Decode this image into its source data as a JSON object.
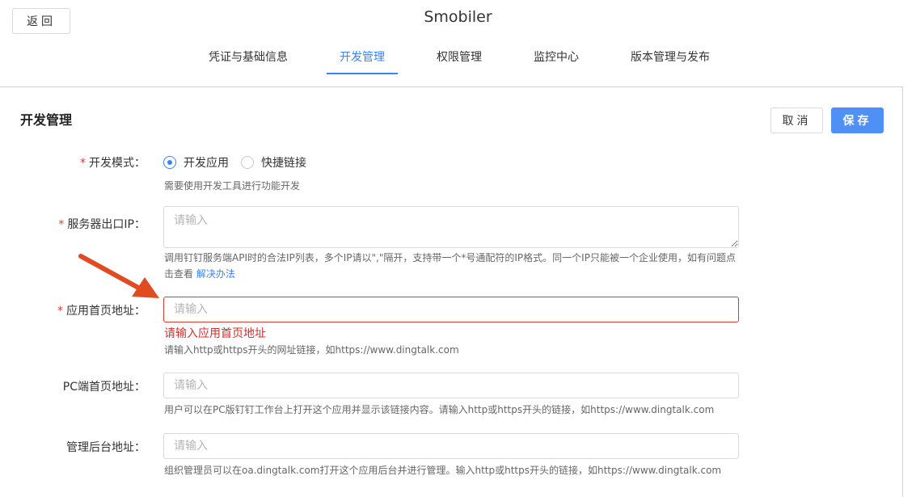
{
  "header": {
    "back_label": "返回",
    "app_title": "Smobiler",
    "tabs": [
      {
        "label": "凭证与基础信息"
      },
      {
        "label": "开发管理"
      },
      {
        "label": "权限管理"
      },
      {
        "label": "监控中心"
      },
      {
        "label": "版本管理与发布"
      }
    ],
    "active_tab": "开发管理"
  },
  "section": {
    "title": "开发管理",
    "cancel_label": "取消",
    "save_label": "保存"
  },
  "form": {
    "dev_mode": {
      "label": "开发模式：",
      "required": true,
      "options": [
        {
          "label": "开发应用",
          "selected": true
        },
        {
          "label": "快捷链接",
          "selected": false
        }
      ],
      "help": "需要使用开发工具进行功能开发"
    },
    "server_ip": {
      "label": "服务器出口IP：",
      "required": true,
      "placeholder": "请输入",
      "value": "",
      "help_line1": "调用钉钉服务端API时的合法IP列表，多个IP请以\",\"隔开，支持带一个*号通配符的IP格式。同一个IP只能被一个企业使用，如有问题点",
      "help_line2_prefix": "击查看 ",
      "help_link": "解决办法"
    },
    "home_url": {
      "label": "应用首页地址：",
      "required": true,
      "placeholder": "请输入",
      "value": "",
      "error": "请输入应用首页地址",
      "help": "请输入http或https开头的网址链接，如https://www.dingtalk.com"
    },
    "pc_home_url": {
      "label": "PC端首页地址：",
      "required": false,
      "placeholder": "请输入",
      "value": "",
      "help": "用户可以在PC版钉钉工作台上打开这个应用并显示该链接内容。请输入http或https开头的链接，如https://www.dingtalk.com"
    },
    "admin_url": {
      "label": "管理后台地址：",
      "required": false,
      "placeholder": "请输入",
      "value": "",
      "help": "组织管理员可以在oa.dingtalk.com打开这个应用后台并进行管理。输入http或https开头的链接，如https://www.dingtalk.com"
    }
  },
  "colors": {
    "accent": "#3a84f5",
    "save_button": "#4f90f6",
    "error": "#d32f2f",
    "annotation_arrow": "#e04b22"
  },
  "icons": [
    "annotation-arrow-icon"
  ]
}
